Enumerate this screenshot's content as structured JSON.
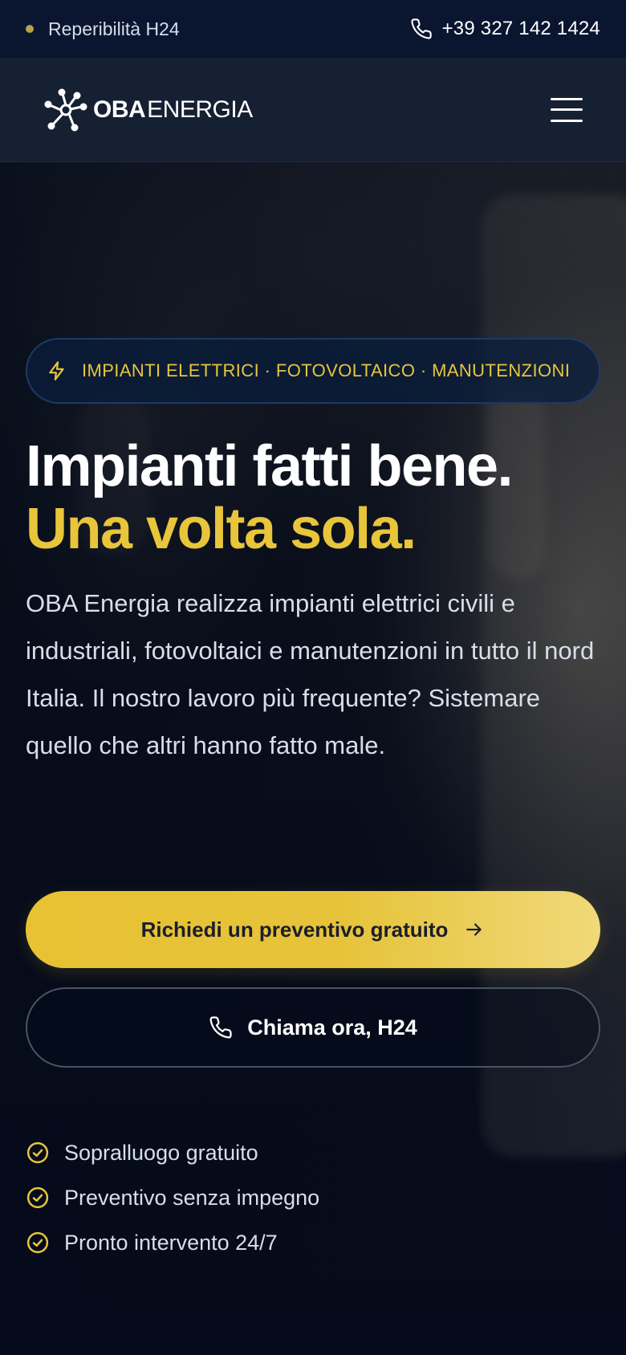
{
  "topbar": {
    "availability": "Reperibilità H24",
    "phone": "+39 327 142 1424",
    "icons": {
      "status": "status-dot",
      "phone": "phone-icon"
    }
  },
  "nav": {
    "brand_strong": "OBA",
    "brand_light": "ENERGIA",
    "icons": {
      "logo": "atom-network-logo",
      "menu": "hamburger-menu-icon"
    }
  },
  "hero": {
    "badge": "IMPIANTI ELETTRICI · FOTOVOLTAICO · MANUTENZIONI",
    "headline_line1": "Impianti fatti bene.",
    "headline_line2": "Una volta sola.",
    "intro": "OBA Energia realizza impianti elettrici civili e industriali, fotovoltaici e manutenzioni in tutto il nord Italia. Il nostro lavoro più frequente? Sistemare quello che altri hanno fatto male.",
    "cta_primary": "Richiedi un preventivo gratuito",
    "cta_secondary": "Chiama ora, H24",
    "benefits": [
      {
        "label": "Sopralluogo gratuito"
      },
      {
        "label": "Preventivo senza impegno"
      },
      {
        "label": "Pronto intervento 24/7"
      }
    ]
  },
  "colors": {
    "accent_yellow": "#e8c53a",
    "background_dark": "#050b1a",
    "topbar": "#0a1630",
    "navbar": "#162033"
  }
}
